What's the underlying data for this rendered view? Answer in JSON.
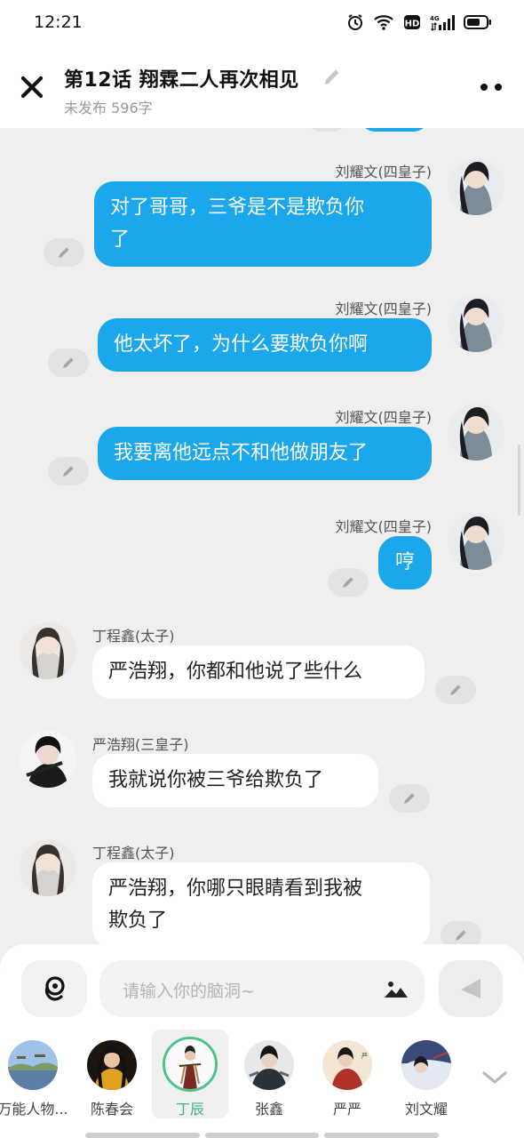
{
  "status_bar": {
    "time": "12:21",
    "network": "4G"
  },
  "header": {
    "title": "第12话   翔霖二人再次相见",
    "subtitle": "未发布 596字"
  },
  "messages": [
    {
      "side": "right",
      "name": "刘耀文(四皇子)",
      "lines": [
        "对了哥哥，三爷是不是欺负你",
        "了"
      ]
    },
    {
      "side": "right",
      "name": "刘耀文(四皇子)",
      "lines": [
        "他太坏了，为什么要欺负你啊"
      ]
    },
    {
      "side": "right",
      "name": "刘耀文(四皇子)",
      "lines": [
        "我要离他远点不和他做朋友了"
      ]
    },
    {
      "side": "right",
      "name": "刘耀文(四皇子)",
      "lines": [
        "哼"
      ]
    },
    {
      "side": "left",
      "name": "丁程鑫(太子)",
      "lines": [
        "严浩翔，你都和他说了些什么"
      ]
    },
    {
      "side": "left",
      "name": "严浩翔(三皇子)",
      "lines": [
        "我就说你被三爷给欺负了"
      ]
    },
    {
      "side": "left",
      "name": "丁程鑫(太子)",
      "lines": [
        "严浩翔，你哪只眼睛看到我被",
        "欺负了"
      ]
    }
  ],
  "input": {
    "placeholder": "请输入你的脑洞~"
  },
  "characters": [
    {
      "label": "万能人物...",
      "selected": false
    },
    {
      "label": "陈春会",
      "selected": false
    },
    {
      "label": "丁辰",
      "selected": true
    },
    {
      "label": "张鑫",
      "selected": false
    },
    {
      "label": "严严",
      "selected": false
    },
    {
      "label": "刘文耀",
      "selected": false
    }
  ],
  "colors": {
    "accent_blue": "#1aa7ec",
    "selected_green": "#4cc38a",
    "background": "#efefef"
  },
  "icons": {
    "close": "close-icon",
    "more": "more-icon",
    "brain": "brain-icon",
    "image": "image-icon",
    "send": "send-icon",
    "edit": "pencil-icon"
  }
}
